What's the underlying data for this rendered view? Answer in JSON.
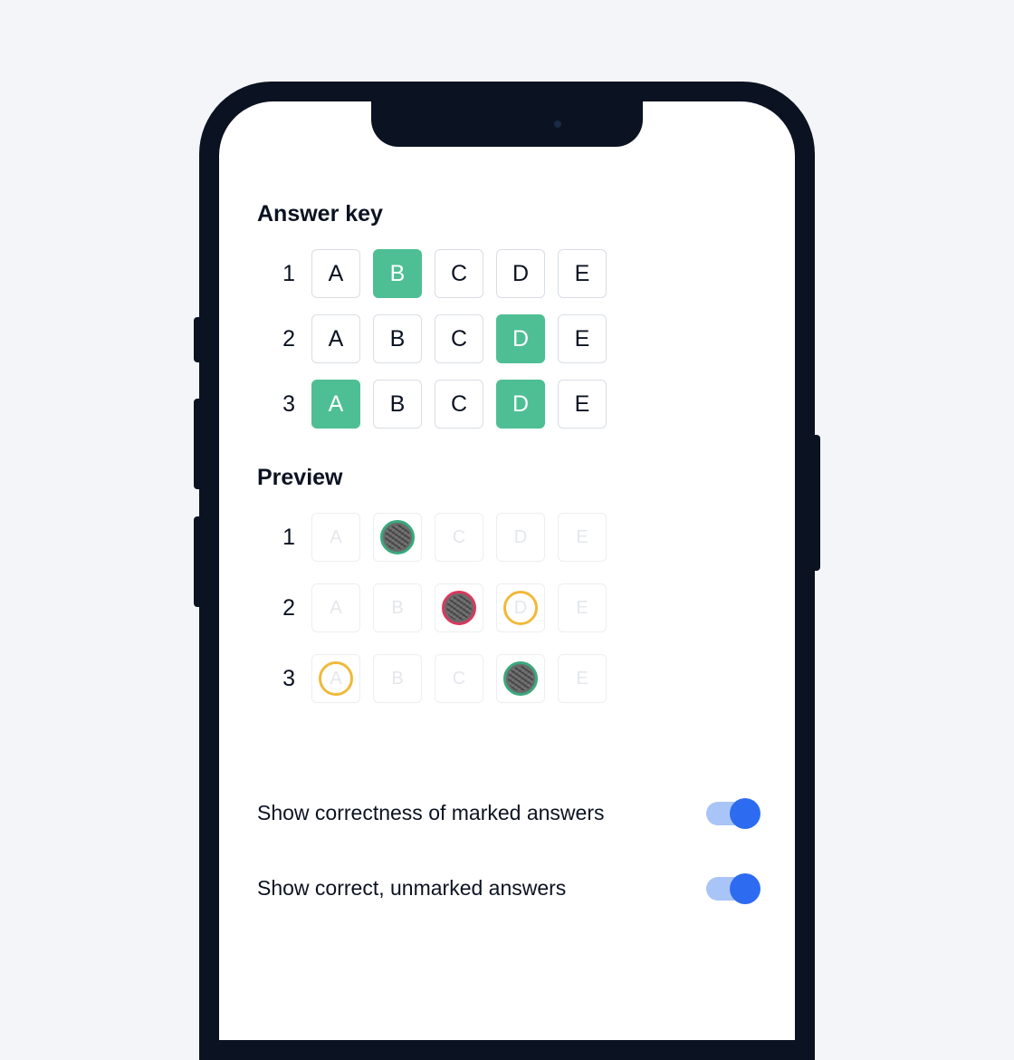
{
  "colors": {
    "accent": "#4ebf94",
    "green": "#3aa97e",
    "red": "#d9395d",
    "yellow": "#f0b93a",
    "toggle": "#2d6cf0"
  },
  "sections": {
    "answer_key_title": "Answer key",
    "preview_title": "Preview"
  },
  "answer_key": {
    "options": [
      "A",
      "B",
      "C",
      "D",
      "E"
    ],
    "rows": [
      {
        "num": "1",
        "selected": [
          "B"
        ]
      },
      {
        "num": "2",
        "selected": [
          "D"
        ]
      },
      {
        "num": "3",
        "selected": [
          "A",
          "D"
        ]
      }
    ]
  },
  "preview": {
    "options": [
      "A",
      "B",
      "C",
      "D",
      "E"
    ],
    "rows": [
      {
        "num": "1",
        "cells": [
          {
            "label": "A",
            "marked": false,
            "ring": null
          },
          {
            "label": "B",
            "marked": true,
            "ring": "green"
          },
          {
            "label": "C",
            "marked": false,
            "ring": null
          },
          {
            "label": "D",
            "marked": false,
            "ring": null
          },
          {
            "label": "E",
            "marked": false,
            "ring": null
          }
        ]
      },
      {
        "num": "2",
        "cells": [
          {
            "label": "A",
            "marked": false,
            "ring": null
          },
          {
            "label": "B",
            "marked": false,
            "ring": null
          },
          {
            "label": "C",
            "marked": true,
            "ring": "red"
          },
          {
            "label": "D",
            "marked": false,
            "ring": "yellow"
          },
          {
            "label": "E",
            "marked": false,
            "ring": null
          }
        ]
      },
      {
        "num": "3",
        "cells": [
          {
            "label": "A",
            "marked": false,
            "ring": "yellow"
          },
          {
            "label": "B",
            "marked": false,
            "ring": null
          },
          {
            "label": "C",
            "marked": false,
            "ring": null
          },
          {
            "label": "D",
            "marked": true,
            "ring": "green"
          },
          {
            "label": "E",
            "marked": false,
            "ring": null
          }
        ]
      }
    ]
  },
  "settings": [
    {
      "label": "Show correctness of marked answers",
      "on": true
    },
    {
      "label": "Show correct, unmarked answers",
      "on": true
    }
  ]
}
